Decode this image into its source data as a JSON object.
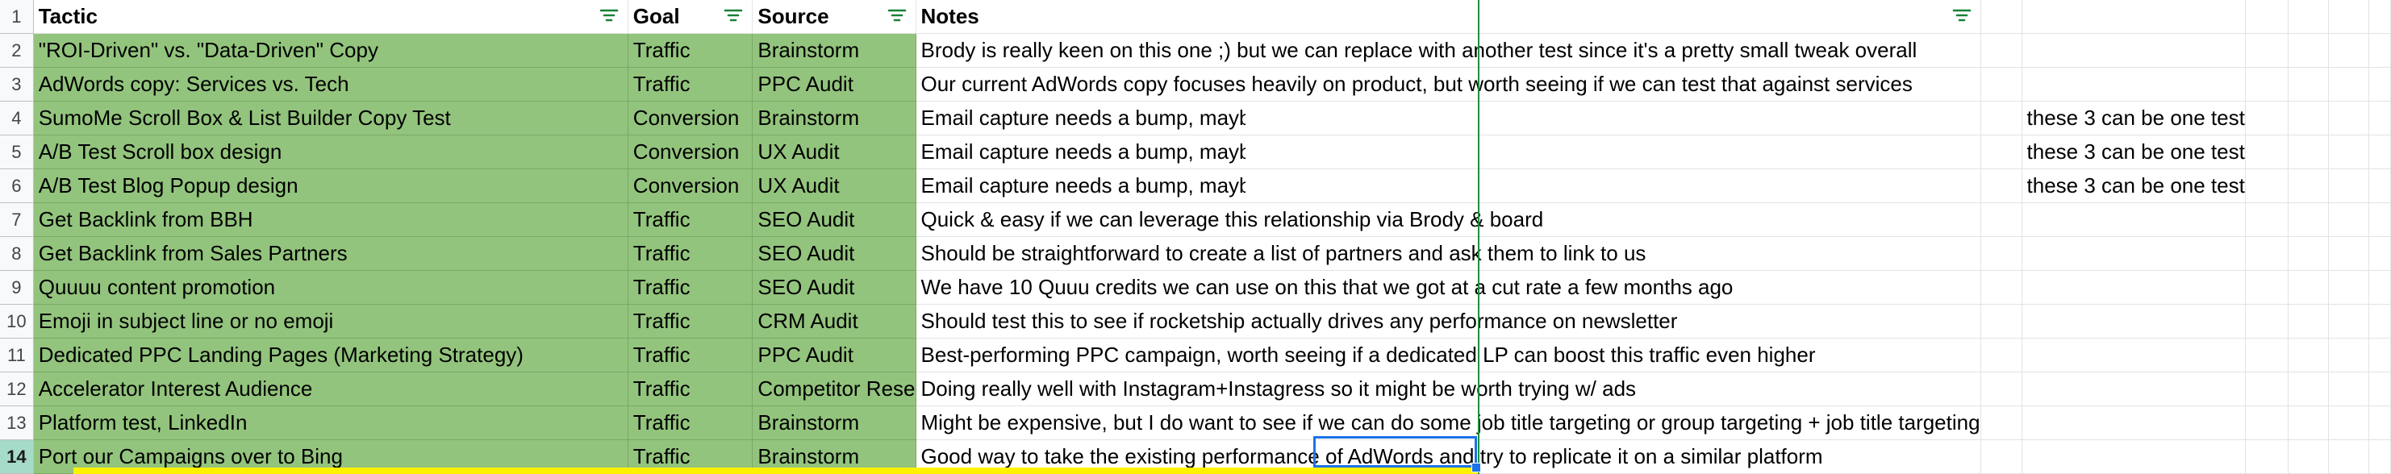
{
  "headers": {
    "row_number": "1",
    "tactic": "Tactic",
    "goal": "Goal",
    "source": "Source",
    "notes": "Notes"
  },
  "rows": [
    {
      "num": "2",
      "tactic": "\"ROI-Driven\" vs. \"Data-Driven\" Copy",
      "goal": "Traffic",
      "source": "Brainstorm",
      "notes": "Brody is really keen on this one ;) but we can replace with another test since it's a pretty small tweak overall",
      "extra": ""
    },
    {
      "num": "3",
      "tactic": "AdWords copy: Services vs. Tech",
      "goal": "Traffic",
      "source": "PPC Audit",
      "notes": "Our current AdWords copy focuses heavily on product, but worth seeing if we can test that against services",
      "extra": ""
    },
    {
      "num": "4",
      "tactic": "SumoMe Scroll Box & List Builder Copy Test",
      "goal": "Conversion",
      "source": "Brainstorm",
      "notes": "Email capture needs a bump, maybe copy is the problem",
      "extra": "these 3 can be one test"
    },
    {
      "num": "5",
      "tactic": "A/B Test Scroll box design",
      "goal": "Conversion",
      "source": "UX Audit",
      "notes": "Email capture needs a bump, maybe design is the problem",
      "extra": "these 3 can be one test"
    },
    {
      "num": "6",
      "tactic": "A/B Test Blog Popup design",
      "goal": "Conversion",
      "source": "UX Audit",
      "notes": "Email capture needs a bump, maybe design is the problem",
      "extra": "these 3 can be one test"
    },
    {
      "num": "7",
      "tactic": "Get Backlink from BBH",
      "goal": "Traffic",
      "source": "SEO Audit",
      "notes": "Quick & easy if we can leverage this relationship via Brody & board",
      "extra": ""
    },
    {
      "num": "8",
      "tactic": "Get Backlink from Sales Partners",
      "goal": "Traffic",
      "source": "SEO Audit",
      "notes": "Should be straightforward to create a list of partners and ask them to link to us",
      "extra": ""
    },
    {
      "num": "9",
      "tactic": "Quuuu content promotion",
      "goal": "Traffic",
      "source": "SEO Audit",
      "notes": "We have 10 Quuu credits we can use on this that we got at a cut rate a few months ago",
      "extra": ""
    },
    {
      "num": "10",
      "tactic": "Emoji in subject line or no emoji",
      "goal": "Traffic",
      "source": "CRM Audit",
      "notes": "Should test this to see if rocketship actually drives any performance on newsletter",
      "extra": ""
    },
    {
      "num": "11",
      "tactic": "Dedicated PPC Landing Pages (Marketing Strategy)",
      "goal": "Traffic",
      "source": "PPC Audit",
      "notes": "Best-performing PPC campaign, worth seeing if a dedicated LP can boost this traffic even higher",
      "extra": ""
    },
    {
      "num": "12",
      "tactic": "Accelerator Interest Audience",
      "goal": "Traffic",
      "source": "Competitor Rese",
      "notes": "Doing really well with Instagram+Instagress so it might be worth trying w/ ads",
      "extra": ""
    },
    {
      "num": "13",
      "tactic": "Platform test, LinkedIn",
      "goal": "Traffic",
      "source": "Brainstorm",
      "notes": "Might be expensive, but I do want to see if we can do some job title targeting or group targeting + job title targeting",
      "extra": ""
    },
    {
      "num": "14",
      "tactic": "Port our Campaigns over to Bing",
      "goal": "Traffic",
      "source": "Brainstorm",
      "notes": "Good way to take the existing performance of AdWords and try to replicate it on a similar platform",
      "extra": ""
    }
  ],
  "colors": {
    "row_fill": "#93c47d",
    "active_row_header": "#a6dac9",
    "selection": "#1a73e8",
    "freeze_line": "#1e8e3e",
    "highlight_border": "#fff200"
  },
  "icons": {
    "filter": "filter-icon"
  }
}
